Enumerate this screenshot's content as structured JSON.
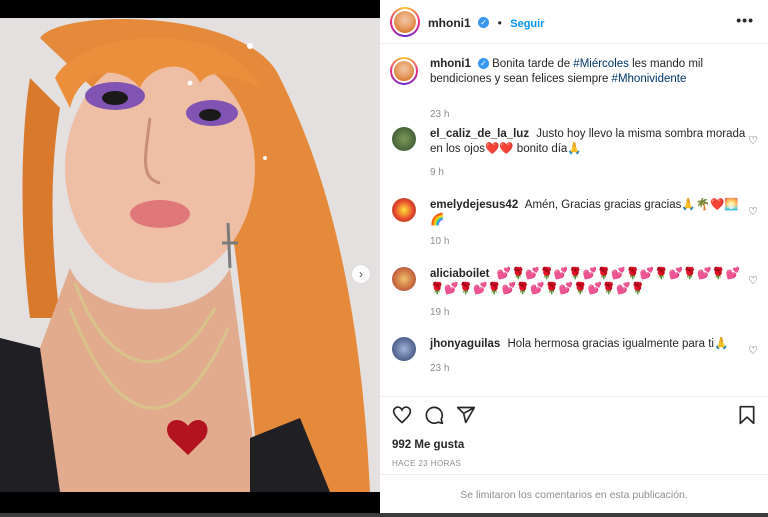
{
  "post": {
    "author": "mhoni1",
    "follow_label": "Seguir",
    "separator": "•",
    "more_label": "•••"
  },
  "caption": {
    "username": "mhoni1",
    "text_before": "Bonita tarde de ",
    "hashtag1": "#Miércoles",
    "text_after": " les mando mil bendiciones y sean felices siempre ",
    "hashtag2": "#Mhonividente",
    "time": "23 h"
  },
  "comments": [
    {
      "username": "el_caliz_de_la_luz",
      "text": "Justo hoy llevo la misma sombra morada en los ojos❤️❤️ bonito día🙏",
      "time": "9 h"
    },
    {
      "username": "emelydejesus42",
      "text": "Amén, Gracias gracias gracias🙏🌴❤️🌅🌈",
      "time": "10 h"
    },
    {
      "username": "aliciaboilet",
      "text": "💕🌹💕🌹💕🌹💕🌹💕🌹💕🌹💕🌹💕🌹💕🌹💕🌹💕🌹💕🌹💕🌹💕🌹💕🌹💕🌹",
      "time": "19 h"
    },
    {
      "username": "jhonyaguilas",
      "text": "Hola hermosa gracias igualmente para ti🙏",
      "time": "23 h"
    }
  ],
  "actions": {
    "likes": "992 Me gusta",
    "posted_ago": "HACE 23 HORAS",
    "comments_limited": "Se limitaron los comentarios en esta publicación."
  },
  "media": {
    "next_label": "›",
    "slide_count": 3,
    "active_slide": 1
  },
  "icons": {
    "like": "heart-icon",
    "comment": "comment-icon",
    "share": "share-icon",
    "save": "bookmark-icon",
    "verified": "verified-badge-icon",
    "more": "more-options-icon"
  },
  "colors": {
    "accent": "#0095f6",
    "hashtag": "#00376b",
    "verified": "#3897f0",
    "muted": "#8e8e8e"
  }
}
